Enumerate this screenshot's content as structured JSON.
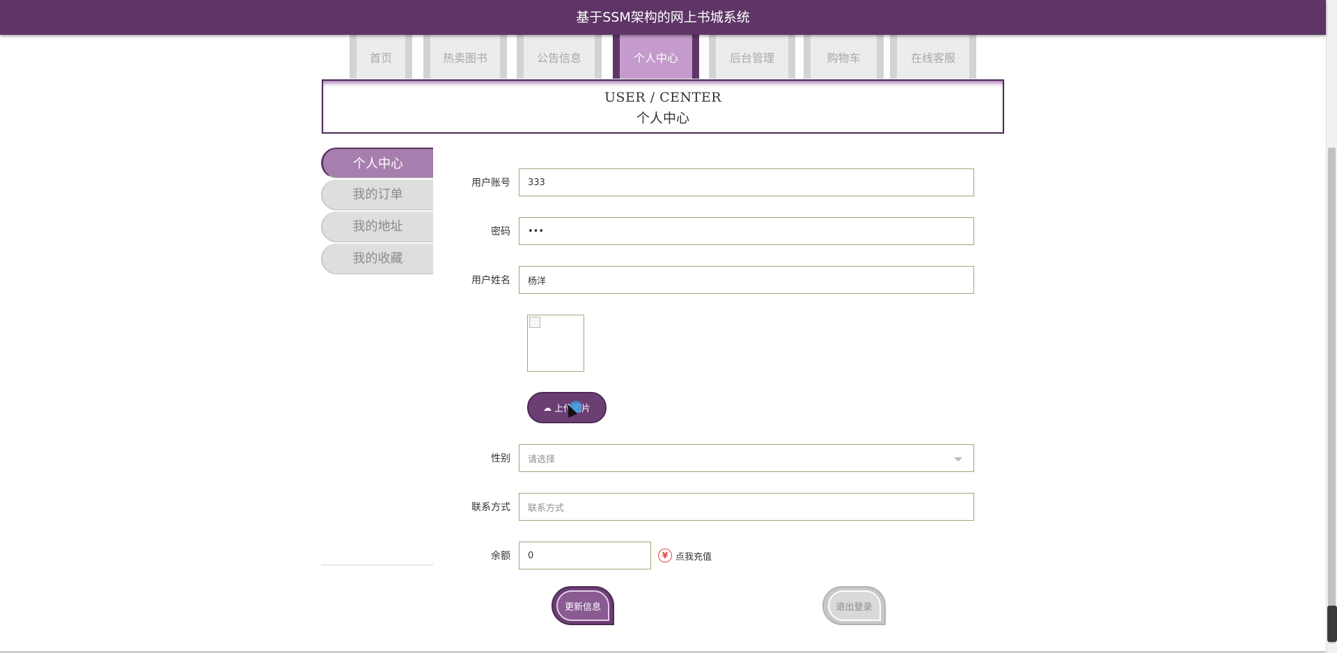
{
  "header": {
    "title": "基于SSM架构的网上书城系统"
  },
  "nav": {
    "items": [
      {
        "label": "首页"
      },
      {
        "label": "热卖图书"
      },
      {
        "label": "公告信息"
      },
      {
        "label": "个人中心"
      },
      {
        "label": "后台管理"
      },
      {
        "label": "购物车"
      },
      {
        "label": "在线客服"
      }
    ],
    "active": "个人中心"
  },
  "section": {
    "title_en": "USER / CENTER",
    "title_cn": "个人中心"
  },
  "sidemenu": {
    "items": [
      {
        "label": "个人中心"
      },
      {
        "label": "我的订单"
      },
      {
        "label": "我的地址"
      },
      {
        "label": "我的收藏"
      }
    ],
    "active": "个人中心"
  },
  "form": {
    "account": {
      "label": "用户账号",
      "value": "333"
    },
    "password": {
      "label": "密码",
      "value": "•••"
    },
    "name": {
      "label": "用户姓名",
      "value": "杨洋"
    },
    "upload": {
      "label": "上传图片",
      "icon": "cloud-upload-icon"
    },
    "gender": {
      "label": "性别",
      "placeholder": "请选择"
    },
    "contact": {
      "label": "联系方式",
      "placeholder": "联系方式"
    },
    "balance": {
      "label": "余额",
      "value": "0",
      "recharge": "点我充值",
      "icon": "yen-icon"
    }
  },
  "actions": {
    "update": "更新信息",
    "logout": "退出登录"
  },
  "colors": {
    "primary": "#5e3566",
    "accent": "#c49bcc",
    "recharge_icon": "#e2463d"
  }
}
